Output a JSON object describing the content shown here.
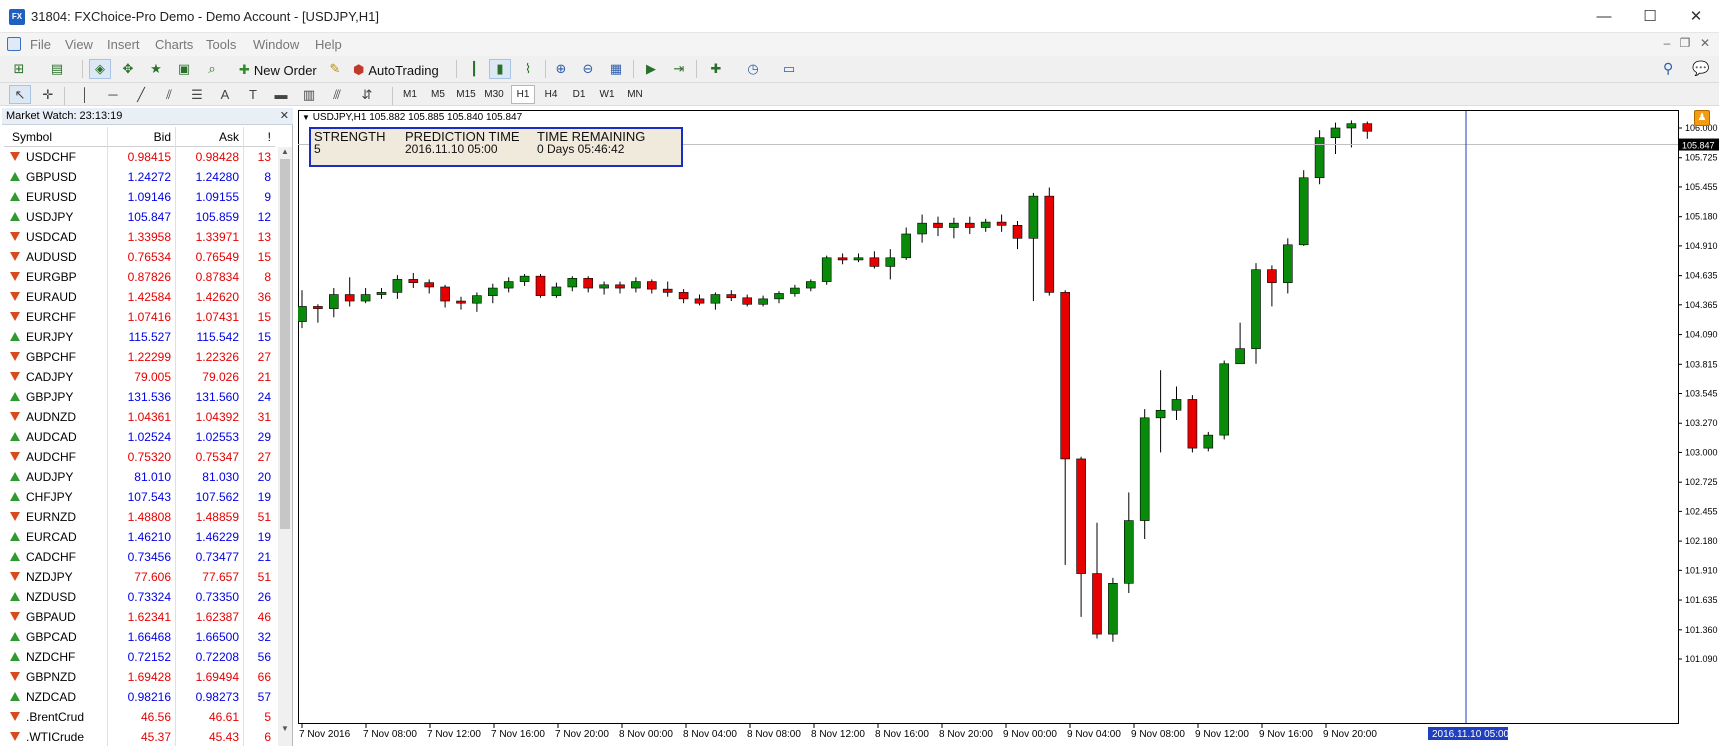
{
  "window": {
    "logo_text": "FX",
    "title": "31804: FXChoice-Pro Demo - Demo Account - [USDJPY,H1]",
    "minimize": "—",
    "maximize": "☐",
    "close": "✕"
  },
  "menu": [
    "File",
    "View",
    "Insert",
    "Charts",
    "Tools",
    "Window",
    "Help"
  ],
  "toolbar": {
    "new_order": "New Order",
    "auto_trading": "AutoTrading",
    "timeframes": [
      "M1",
      "M5",
      "M15",
      "M30",
      "H1",
      "H4",
      "D1",
      "W1",
      "MN"
    ],
    "active_timeframe": "H1"
  },
  "market_watch": {
    "header": "Market Watch: 23:13:19",
    "columns": {
      "symbol": "Symbol",
      "bid": "Bid",
      "ask": "Ask",
      "spread": "!"
    },
    "rows": [
      {
        "symbol": "USDCHF",
        "bid": "0.98415",
        "ask": "0.98428",
        "spread": "13",
        "dir": "down"
      },
      {
        "symbol": "GBPUSD",
        "bid": "1.24272",
        "ask": "1.24280",
        "spread": "8",
        "dir": "up"
      },
      {
        "symbol": "EURUSD",
        "bid": "1.09146",
        "ask": "1.09155",
        "spread": "9",
        "dir": "up"
      },
      {
        "symbol": "USDJPY",
        "bid": "105.847",
        "ask": "105.859",
        "spread": "12",
        "dir": "up"
      },
      {
        "symbol": "USDCAD",
        "bid": "1.33958",
        "ask": "1.33971",
        "spread": "13",
        "dir": "down"
      },
      {
        "symbol": "AUDUSD",
        "bid": "0.76534",
        "ask": "0.76549",
        "spread": "15",
        "dir": "down"
      },
      {
        "symbol": "EURGBP",
        "bid": "0.87826",
        "ask": "0.87834",
        "spread": "8",
        "dir": "down"
      },
      {
        "symbol": "EURAUD",
        "bid": "1.42584",
        "ask": "1.42620",
        "spread": "36",
        "dir": "down"
      },
      {
        "symbol": "EURCHF",
        "bid": "1.07416",
        "ask": "1.07431",
        "spread": "15",
        "dir": "down"
      },
      {
        "symbol": "EURJPY",
        "bid": "115.527",
        "ask": "115.542",
        "spread": "15",
        "dir": "up"
      },
      {
        "symbol": "GBPCHF",
        "bid": "1.22299",
        "ask": "1.22326",
        "spread": "27",
        "dir": "down"
      },
      {
        "symbol": "CADJPY",
        "bid": "79.005",
        "ask": "79.026",
        "spread": "21",
        "dir": "down"
      },
      {
        "symbol": "GBPJPY",
        "bid": "131.536",
        "ask": "131.560",
        "spread": "24",
        "dir": "up"
      },
      {
        "symbol": "AUDNZD",
        "bid": "1.04361",
        "ask": "1.04392",
        "spread": "31",
        "dir": "down"
      },
      {
        "symbol": "AUDCAD",
        "bid": "1.02524",
        "ask": "1.02553",
        "spread": "29",
        "dir": "up"
      },
      {
        "symbol": "AUDCHF",
        "bid": "0.75320",
        "ask": "0.75347",
        "spread": "27",
        "dir": "down"
      },
      {
        "symbol": "AUDJPY",
        "bid": "81.010",
        "ask": "81.030",
        "spread": "20",
        "dir": "up"
      },
      {
        "symbol": "CHFJPY",
        "bid": "107.543",
        "ask": "107.562",
        "spread": "19",
        "dir": "up"
      },
      {
        "symbol": "EURNZD",
        "bid": "1.48808",
        "ask": "1.48859",
        "spread": "51",
        "dir": "down"
      },
      {
        "symbol": "EURCAD",
        "bid": "1.46210",
        "ask": "1.46229",
        "spread": "19",
        "dir": "up"
      },
      {
        "symbol": "CADCHF",
        "bid": "0.73456",
        "ask": "0.73477",
        "spread": "21",
        "dir": "up"
      },
      {
        "symbol": "NZDJPY",
        "bid": "77.606",
        "ask": "77.657",
        "spread": "51",
        "dir": "down"
      },
      {
        "symbol": "NZDUSD",
        "bid": "0.73324",
        "ask": "0.73350",
        "spread": "26",
        "dir": "up"
      },
      {
        "symbol": "GBPAUD",
        "bid": "1.62341",
        "ask": "1.62387",
        "spread": "46",
        "dir": "down"
      },
      {
        "symbol": "GBPCAD",
        "bid": "1.66468",
        "ask": "1.66500",
        "spread": "32",
        "dir": "up"
      },
      {
        "symbol": "NZDCHF",
        "bid": "0.72152",
        "ask": "0.72208",
        "spread": "56",
        "dir": "up"
      },
      {
        "symbol": "GBPNZD",
        "bid": "1.69428",
        "ask": "1.69494",
        "spread": "66",
        "dir": "down"
      },
      {
        "symbol": "NZDCAD",
        "bid": "0.98216",
        "ask": "0.98273",
        "spread": "57",
        "dir": "up"
      },
      {
        "symbol": ".BrentCrud",
        "bid": "46.56",
        "ask": "46.61",
        "spread": "5",
        "dir": "down"
      },
      {
        "symbol": ".WTICrude",
        "bid": "45.37",
        "ask": "45.43",
        "spread": "6",
        "dir": "down"
      }
    ]
  },
  "chart": {
    "caption": "USDJPY,H1  105.882 105.885 105.840 105.847",
    "info_box": {
      "strength_label": "STRENGTH",
      "strength_value": "5",
      "prediction_label": "PREDICTION TIME",
      "prediction_value": "2016.11.10 05:00",
      "remaining_label": "TIME REMAINING",
      "remaining_value": "0 Days 05:46:42"
    },
    "price_labels": [
      "106.000",
      "105.725",
      "105.455",
      "105.180",
      "104.910",
      "104.635",
      "104.365",
      "104.090",
      "103.815",
      "103.545",
      "103.270",
      "103.000",
      "102.725",
      "102.455",
      "102.180",
      "101.910",
      "101.635",
      "101.360",
      "101.090"
    ],
    "current_price": "105.847",
    "time_labels": [
      "7 Nov 2016",
      "7 Nov 08:00",
      "7 Nov 12:00",
      "7 Nov 16:00",
      "7 Nov 20:00",
      "8 Nov 00:00",
      "8 Nov 04:00",
      "8 Nov 08:00",
      "8 Nov 12:00",
      "8 Nov 16:00",
      "8 Nov 20:00",
      "9 Nov 00:00",
      "9 Nov 04:00",
      "9 Nov 08:00",
      "9 Nov 12:00",
      "9 Nov 16:00",
      "9 Nov 20:00"
    ],
    "vline_label": "2016.11.10 05:00",
    "colors": {
      "bull": "#0a8a0a",
      "bear": "#e60000",
      "vline": "#1f3fbf",
      "price_tag": "#000000"
    }
  },
  "chart_data": {
    "type": "candlestick",
    "symbol": "USDJPY",
    "timeframe": "H1",
    "ylim": [
      101.09,
      106.0
    ],
    "candles": [
      [
        104.21,
        104.35,
        104.5,
        104.15
      ],
      [
        104.35,
        104.33,
        104.37,
        104.2
      ],
      [
        104.33,
        104.46,
        104.52,
        104.25
      ],
      [
        104.46,
        104.4,
        104.62,
        104.35
      ],
      [
        104.4,
        104.46,
        104.52,
        104.38
      ],
      [
        104.46,
        104.48,
        104.52,
        104.42
      ],
      [
        104.48,
        104.6,
        104.64,
        104.42
      ],
      [
        104.6,
        104.57,
        104.66,
        104.52
      ],
      [
        104.57,
        104.53,
        104.6,
        104.47
      ],
      [
        104.53,
        104.4,
        104.55,
        104.34
      ],
      [
        104.4,
        104.38,
        104.44,
        104.32
      ],
      [
        104.38,
        104.45,
        104.48,
        104.3
      ],
      [
        104.45,
        104.52,
        104.56,
        104.38
      ],
      [
        104.52,
        104.58,
        104.62,
        104.48
      ],
      [
        104.58,
        104.63,
        104.65,
        104.54
      ],
      [
        104.63,
        104.45,
        104.65,
        104.43
      ],
      [
        104.45,
        104.53,
        104.57,
        104.43
      ],
      [
        104.53,
        104.61,
        104.63,
        104.49
      ],
      [
        104.61,
        104.52,
        104.63,
        104.48
      ],
      [
        104.52,
        104.55,
        104.58,
        104.46
      ],
      [
        104.55,
        104.52,
        104.58,
        104.47
      ],
      [
        104.52,
        104.58,
        104.62,
        104.48
      ],
      [
        104.58,
        104.51,
        104.6,
        104.47
      ],
      [
        104.51,
        104.48,
        104.58,
        104.44
      ],
      [
        104.48,
        104.42,
        104.51,
        104.38
      ],
      [
        104.42,
        104.38,
        104.46,
        104.36
      ],
      [
        104.38,
        104.46,
        104.48,
        104.32
      ],
      [
        104.46,
        104.43,
        104.5,
        104.4
      ],
      [
        104.43,
        104.37,
        104.46,
        104.35
      ],
      [
        104.37,
        104.42,
        104.45,
        104.35
      ],
      [
        104.42,
        104.47,
        104.49,
        104.38
      ],
      [
        104.47,
        104.52,
        104.55,
        104.44
      ],
      [
        104.52,
        104.58,
        104.6,
        104.49
      ],
      [
        104.58,
        104.8,
        104.82,
        104.55
      ],
      [
        104.8,
        104.78,
        104.84,
        104.74
      ],
      [
        104.78,
        104.8,
        104.84,
        104.76
      ],
      [
        104.8,
        104.72,
        104.86,
        104.7
      ],
      [
        104.72,
        104.8,
        104.88,
        104.6
      ],
      [
        104.8,
        105.02,
        105.08,
        104.78
      ],
      [
        105.02,
        105.12,
        105.2,
        104.94
      ],
      [
        105.12,
        105.08,
        105.18,
        105.0
      ],
      [
        105.08,
        105.12,
        105.17,
        104.98
      ],
      [
        105.12,
        105.08,
        105.18,
        105.02
      ],
      [
        105.08,
        105.13,
        105.16,
        105.04
      ],
      [
        105.13,
        105.1,
        105.2,
        105.04
      ],
      [
        105.1,
        104.98,
        105.14,
        104.88
      ],
      [
        104.98,
        105.37,
        105.4,
        104.4
      ],
      [
        105.37,
        104.48,
        105.45,
        104.45
      ],
      [
        104.48,
        102.94,
        104.5,
        101.96
      ],
      [
        102.94,
        101.88,
        102.96,
        101.48
      ],
      [
        101.88,
        101.32,
        102.35,
        101.28
      ],
      [
        101.32,
        101.79,
        101.84,
        101.25
      ],
      [
        101.79,
        102.37,
        102.63,
        101.7
      ],
      [
        102.37,
        103.32,
        103.4,
        102.2
      ],
      [
        103.32,
        103.39,
        103.76,
        103.0
      ],
      [
        103.39,
        103.49,
        103.61,
        103.3
      ],
      [
        103.49,
        103.04,
        103.53,
        103.0
      ],
      [
        103.04,
        103.16,
        103.19,
        103.01
      ],
      [
        103.16,
        103.82,
        103.85,
        103.12
      ],
      [
        103.82,
        103.96,
        104.2,
        103.82
      ],
      [
        103.96,
        104.69,
        104.75,
        103.82
      ],
      [
        104.69,
        104.57,
        104.73,
        104.35
      ],
      [
        104.57,
        104.92,
        104.98,
        104.47
      ],
      [
        104.92,
        105.54,
        105.61,
        104.91
      ],
      [
        105.54,
        105.91,
        105.98,
        105.48
      ],
      [
        105.91,
        106.0,
        106.05,
        105.76
      ],
      [
        106.0,
        106.04,
        106.07,
        105.82
      ],
      [
        106.04,
        105.97,
        106.06,
        105.9
      ]
    ]
  }
}
